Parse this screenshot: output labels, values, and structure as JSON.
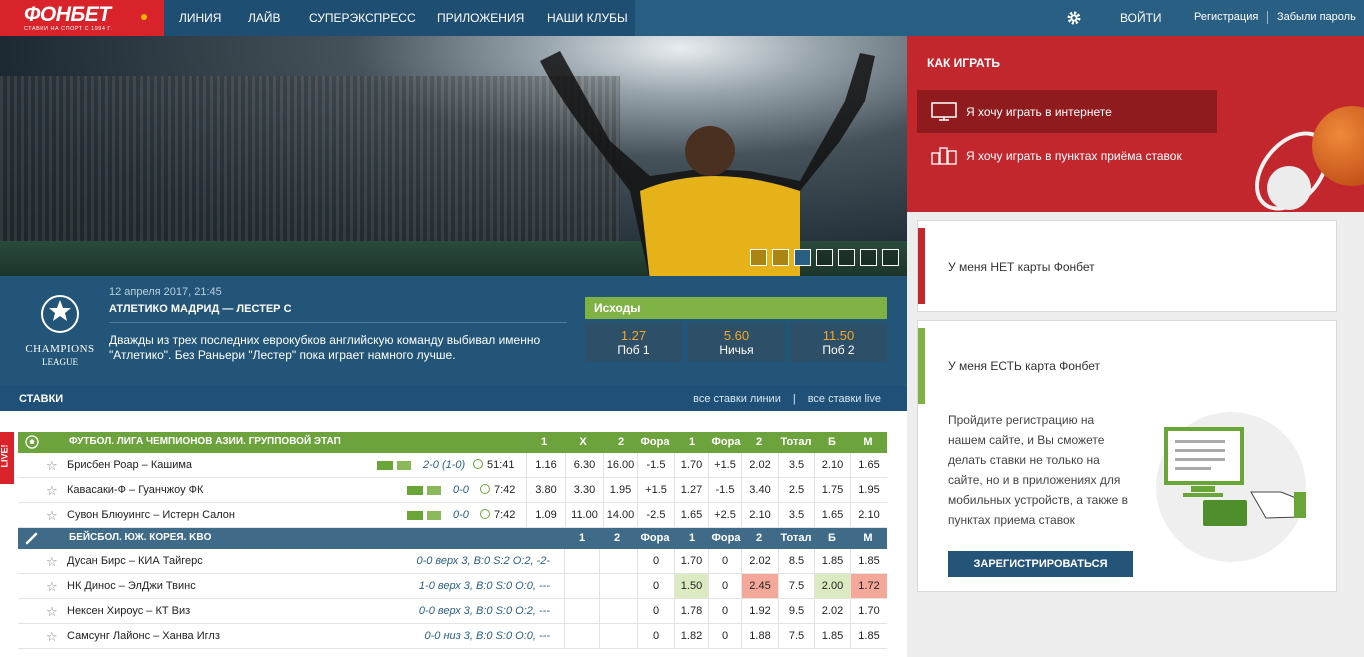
{
  "brand": {
    "name": "ФОНБЕТ",
    "tagline": "СТАВКИ НА СПОРТ С 1994 Г."
  },
  "nav": {
    "items": [
      "ЛИНИЯ",
      "ЛАЙВ",
      "СУПЕРЭКСПРЕСС",
      "ПРИЛОЖЕНИЯ",
      "НАШИ КЛУБЫ"
    ],
    "login": "ВОЙТИ",
    "register": "Регистрация",
    "forgot": "Забыли пароль"
  },
  "featured": {
    "league_logo_text": "CHAMPIONS",
    "league_logo_sub": "LEAGUE",
    "date": "12 апреля 2017, 21:45",
    "title": "АТЛЕТИКО МАДРИД — ЛЕСТЕР С",
    "description": "Дважды из трех последних еврокубков английскую команду выбивал именно \"Атлетико\". Без Раньери \"Лестер\" пока играет намного лучше.",
    "outcomes_label": "Исходы",
    "outcomes": [
      {
        "odd": "1.27",
        "label": "Поб 1"
      },
      {
        "odd": "5.60",
        "label": "Ничья"
      },
      {
        "odd": "11.50",
        "label": "Поб 2"
      }
    ]
  },
  "bets": {
    "title": "СТАВКИ",
    "all_line": "все ставки линии",
    "divider": "|",
    "all_live": "все ставки live"
  },
  "live_tab": "LIVE!",
  "table": {
    "groups": [
      {
        "name": "ФУТБОЛ. ЛИГА ЧЕМПИОНОВ АЗИИ. ГРУППОВОЙ ЭТАП",
        "headers": [
          "1",
          "X",
          "2",
          "Фора",
          "1",
          "Фора",
          "2",
          "Тотал",
          "Б",
          "М"
        ],
        "rows": [
          {
            "name": "Брисбен Роар – Кашима",
            "score": "2-0 (1-0)",
            "time": "51:41",
            "cells": [
              "1.16",
              "6.30",
              "16.00",
              "-1.5",
              "1.70",
              "+1.5",
              "2.02",
              "3.5",
              "2.10",
              "1.65"
            ]
          },
          {
            "name": "Кавасаки-Ф – Гуанчжоу ФК",
            "score": "0-0",
            "time": "7:42",
            "cells": [
              "3.80",
              "3.30",
              "1.95",
              "+1.5",
              "1.27",
              "-1.5",
              "3.40",
              "2.5",
              "1.75",
              "1.95"
            ]
          },
          {
            "name": "Сувон Блюуингс – Истерн Салон",
            "score": "0-0",
            "time": "7:42",
            "cells": [
              "1.09",
              "11.00",
              "14.00",
              "-2.5",
              "1.65",
              "+2.5",
              "2.10",
              "3.5",
              "1.65",
              "2.10"
            ]
          }
        ]
      },
      {
        "name": "БЕЙСБОЛ. ЮЖ. КОРЕЯ. KBO",
        "headers": [
          "1",
          "2",
          "Фора",
          "1",
          "Фора",
          "2",
          "Тотал",
          "Б",
          "М"
        ],
        "rows": [
          {
            "name": "Дусан Бирс – КИА Тайгерс",
            "score": "0-0 верх 3, B:0 S:2 O:2, -2-",
            "cells": [
              "",
              "",
              "0",
              "1.70",
              "0",
              "2.02",
              "8.5",
              "1.85",
              "1.85"
            ]
          },
          {
            "name": "НК Динос – ЭлДжи Твинс",
            "score": "1-0 верх 3, B:0 S:0 O:0, ---",
            "cells": [
              "",
              "",
              "0",
              "1.50",
              "0",
              "2.45",
              "7.5",
              "2.00",
              "1.72"
            ]
          },
          {
            "name": "Нексен Хироус – КТ Виз",
            "score": "0-0 верх 3, B:0 S:0 O:2, ---",
            "cells": [
              "",
              "",
              "0",
              "1.78",
              "0",
              "1.92",
              "9.5",
              "2.02",
              "1.70"
            ]
          },
          {
            "name": "Самсунг Лайонс – Ханва Иглз",
            "score": "0-0 низ 3, B:0 S:0 O:0, ---",
            "cells": [
              "",
              "",
              "0",
              "1.82",
              "0",
              "1.88",
              "7.5",
              "1.85",
              "1.85"
            ]
          }
        ]
      }
    ]
  },
  "sidebar": {
    "how_to_play": "КАК ИГРАТЬ",
    "option_online": "Я хочу играть в интернете",
    "option_points": "Я хочу играть в пунктах приёма ставок",
    "card_no": "У меня НЕТ карты Фонбет",
    "card_yes": "У меня ЕСТЬ карта Фонбет",
    "card_yes_body": "Пройдите регистрацию на нашем сайте, и Вы сможете делать ставки не только на сайте, но и в приложениях для мобильных устройств, а также в пунктах приема ставок",
    "register_button": "ЗАРЕГИСТРИРОВАТЬСЯ"
  },
  "colors": {
    "brand_red": "#d8232a",
    "nav_blue": "#2a5f84",
    "group_green": "#6da33c",
    "odds_orange": "#f5a623",
    "accent_green": "#7fb244"
  }
}
